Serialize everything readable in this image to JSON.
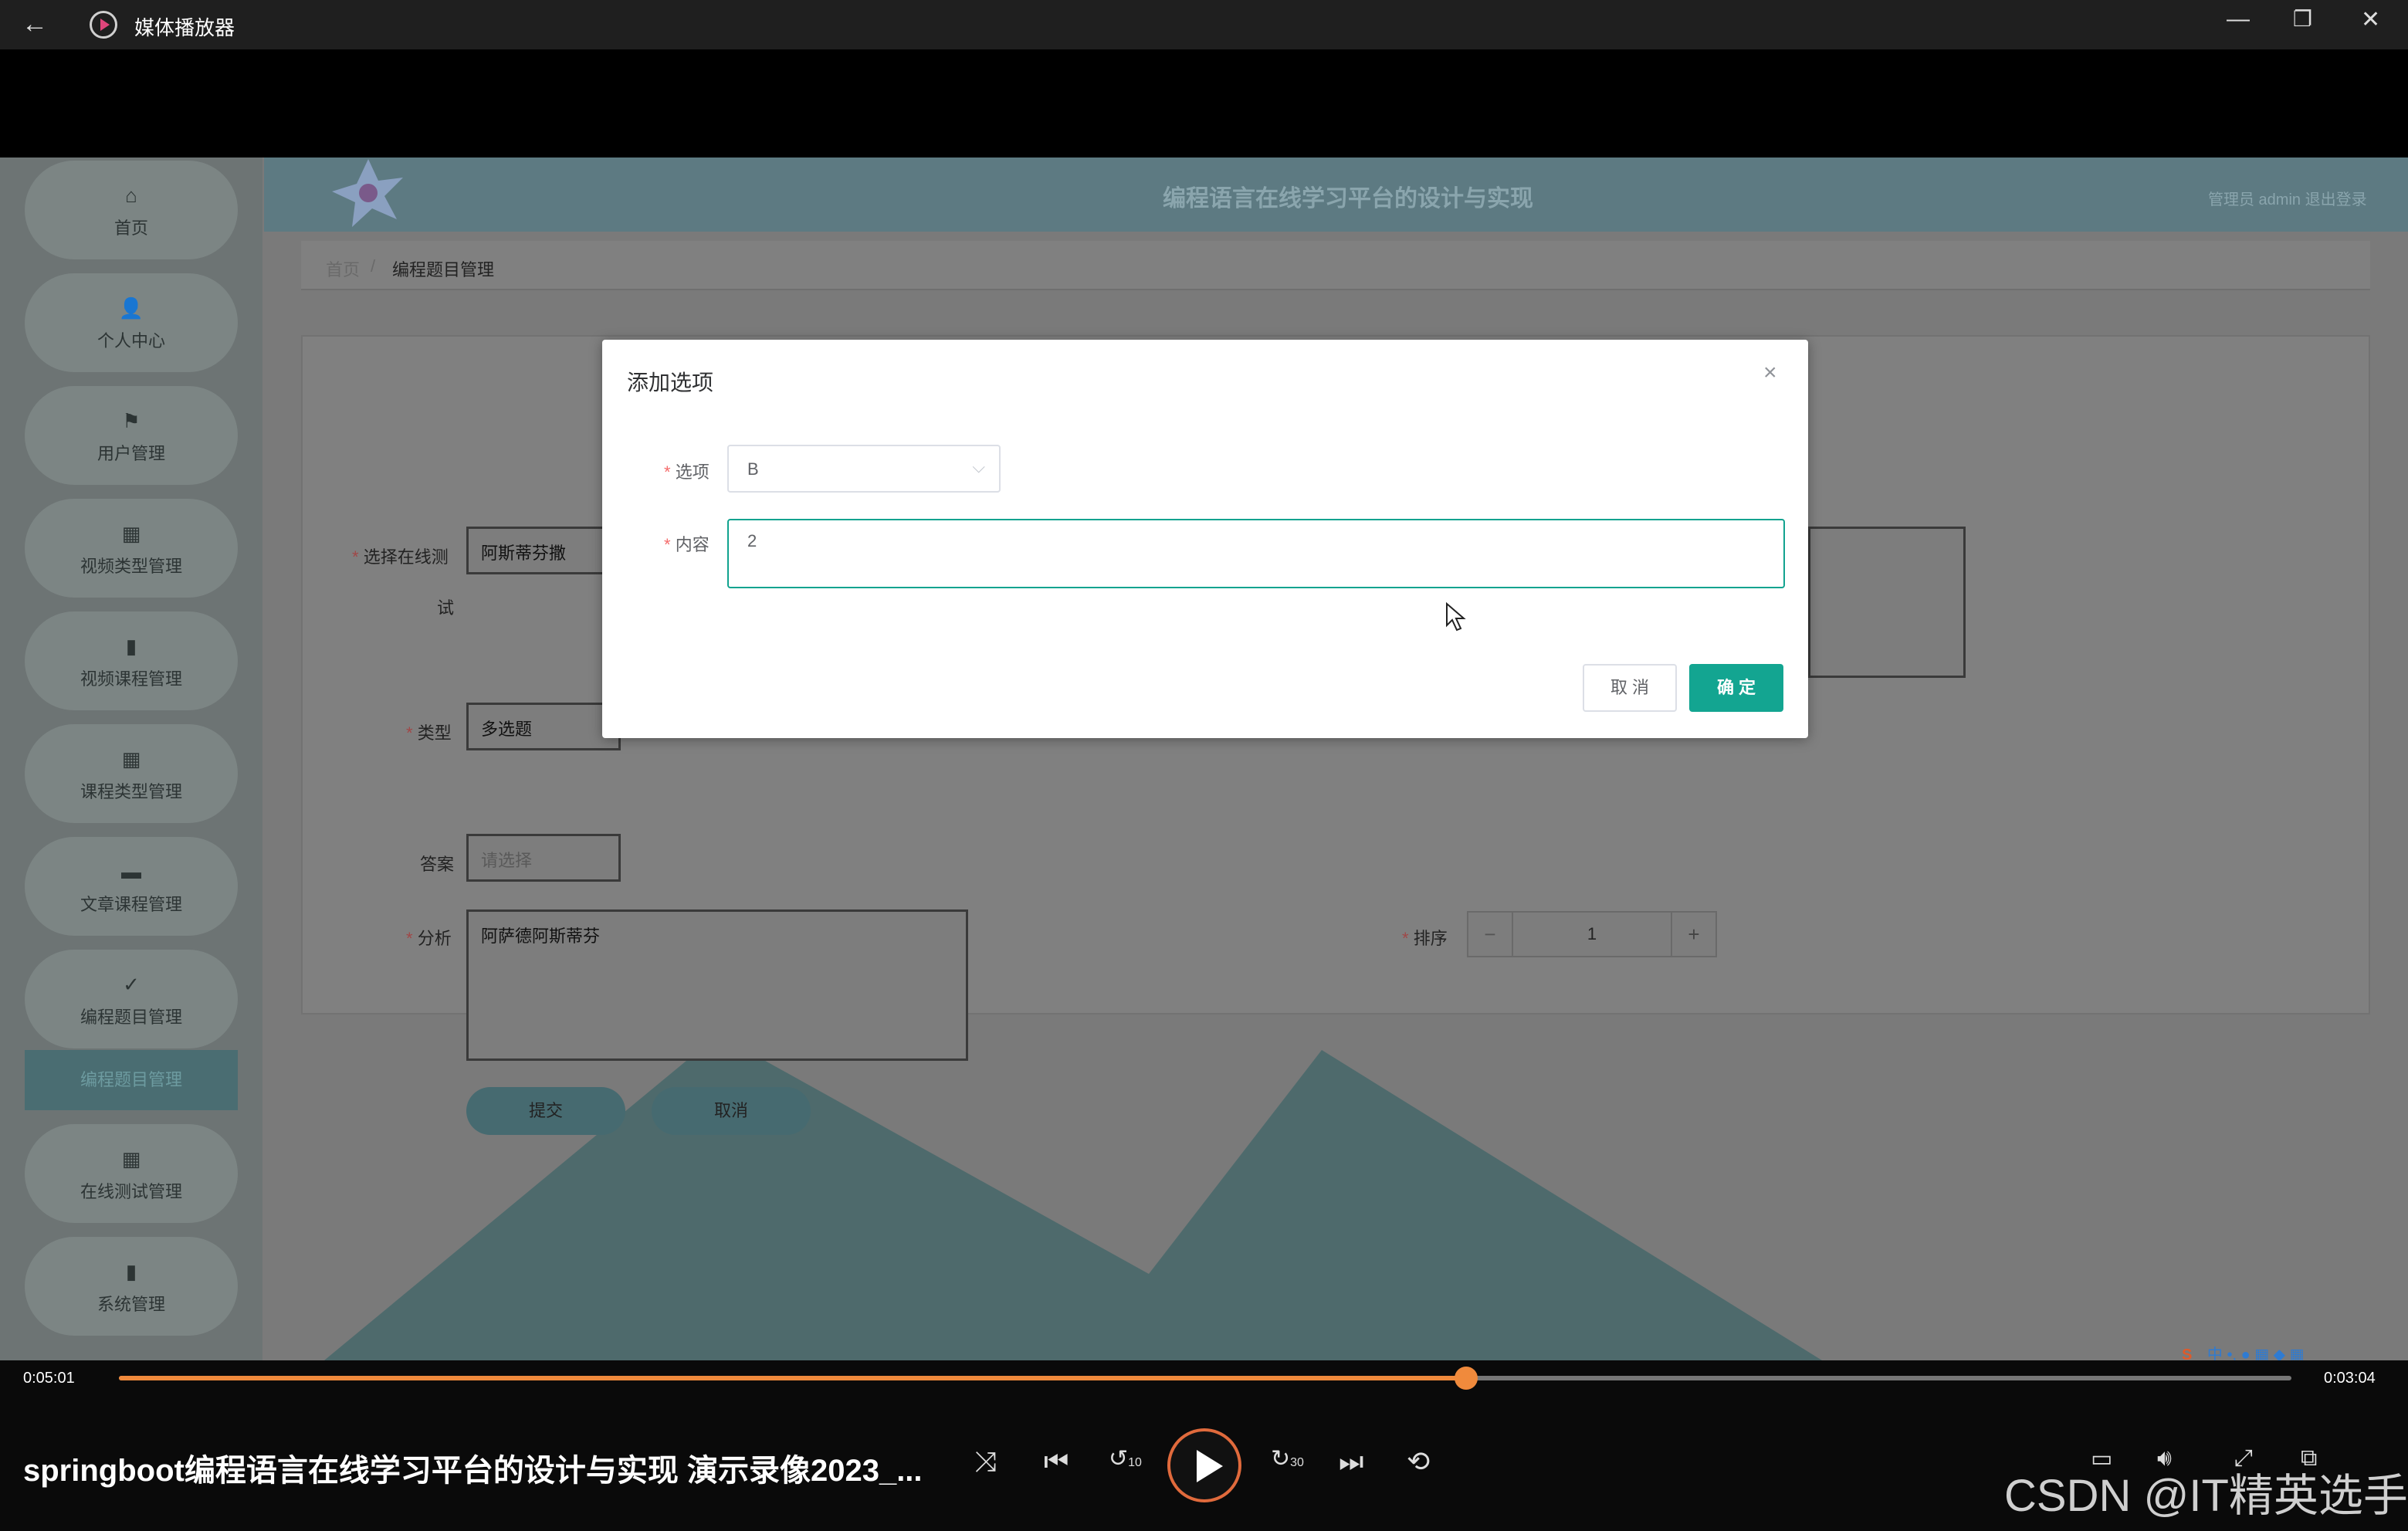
{
  "titlebar": {
    "title": "媒体播放器",
    "back_icon": "back-arrow-icon",
    "minimize": "—",
    "restore": "❐",
    "close": "✕"
  },
  "app": {
    "header_title": "编程语言在线学习平台的设计与实现",
    "header_right": "管理员 admin   退出登录",
    "sidebar": {
      "items": [
        {
          "label": "首页",
          "icon": "⌂"
        },
        {
          "label": "个人中心",
          "icon": "👤"
        },
        {
          "label": "用户管理",
          "icon": "⚑"
        },
        {
          "label": "视频类型管理",
          "icon": "▦"
        },
        {
          "label": "视频课程管理",
          "icon": "▮"
        },
        {
          "label": "课程类型管理",
          "icon": "▦"
        },
        {
          "label": "文章课程管理",
          "icon": "▬"
        },
        {
          "label": "编程题目管理",
          "icon": "✓"
        },
        {
          "label": "在线测试管理",
          "icon": "▦"
        },
        {
          "label": "系统管理",
          "icon": "▮"
        }
      ],
      "active_sub": "编程题目管理"
    },
    "breadcrumb": {
      "home": "首页",
      "sep": "/",
      "current": "编程题目管理"
    },
    "form": {
      "exam_label": "选择在线测",
      "exam_label_2": "试",
      "exam_value": "阿斯蒂芬撒",
      "type_label": "类型",
      "type_value": "多选题",
      "answer_label": "答案",
      "answer_placeholder": "请选择",
      "analysis_label": "分析",
      "analysis_value": "阿萨德阿斯蒂芬",
      "sort_label": "排序",
      "sort_value": "1",
      "minus": "−",
      "plus": "+",
      "submit": "提交",
      "cancel": "取消"
    }
  },
  "dialog": {
    "title": "添加选项",
    "close_icon": "×",
    "option_label": "选项",
    "option_value": "B",
    "content_label": "内容",
    "content_value": "2",
    "cancel": "取 消",
    "confirm": "确 定"
  },
  "player": {
    "elapsed": "0:05:01",
    "remaining": "0:03:04",
    "progress": 0.62,
    "video_title": "springboot编程语言在线学习平台的设计与实现  演示录像2023_...",
    "skip_back": "10",
    "skip_forward": "30",
    "watermark": "CSDN @IT精英选手"
  },
  "colors": {
    "accent": "#13a591",
    "progress": "#f08a3c"
  }
}
